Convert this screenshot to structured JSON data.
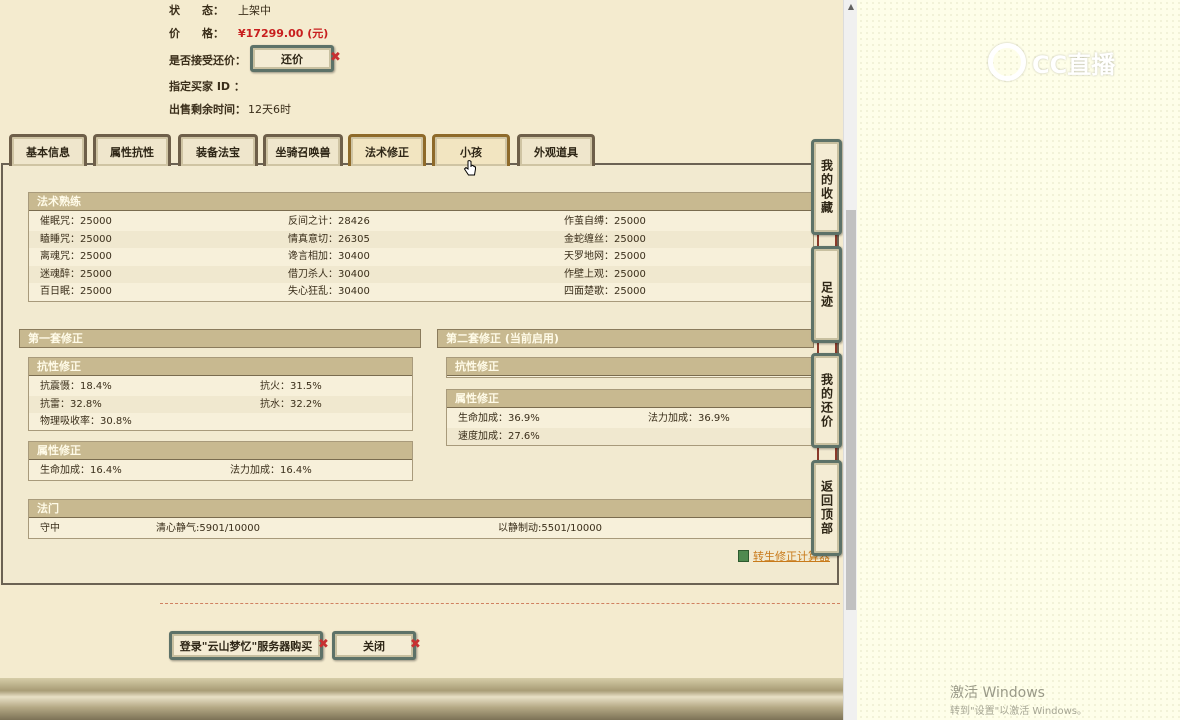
{
  "info": {
    "status_label": "状　　态：",
    "status_value": "上架中",
    "price_label": "价　　格：",
    "price_value": "¥17299.00 (元)",
    "counter_label": "是否接受还价：",
    "counter_button": "还价",
    "buyer_label": "指定买家 ID ：",
    "remaining_label": "出售剩余时间：",
    "remaining_value": "12天6时"
  },
  "tabs": [
    {
      "label": "基本信息"
    },
    {
      "label": "属性抗性"
    },
    {
      "label": "装备法宝"
    },
    {
      "label": "坐骑召唤兽"
    },
    {
      "label": "法术修正"
    },
    {
      "label": "小孩"
    },
    {
      "label": "外观道具"
    }
  ],
  "spell_mastery": {
    "title": "法术熟练",
    "rows": [
      [
        "催眠咒：25000",
        "反间之计：28426",
        "作茧自缚：25000"
      ],
      [
        "瞌睡咒：25000",
        "情真意切：26305",
        "金蛇缠丝：25000"
      ],
      [
        "离魂咒：25000",
        "谗言相加：30400",
        "天罗地网：25000"
      ],
      [
        "迷魂醉：25000",
        "借刀杀人：30400",
        "作壁上观：25000"
      ],
      [
        "百日眠：25000",
        "失心狂乱：30400",
        "四面楚歌：25000"
      ]
    ]
  },
  "set1": {
    "title": "第一套修正",
    "resist": {
      "title": "抗性修正",
      "rows": [
        [
          "抗震慑：18.4%",
          "抗火：31.5%"
        ],
        [
          "抗雷：32.8%",
          "抗水：32.2%"
        ],
        [
          "物理吸收率：30.8%",
          ""
        ]
      ]
    },
    "attr": {
      "title": "属性修正",
      "rows": [
        [
          "生命加成：16.4%",
          "法力加成：16.4%"
        ]
      ]
    }
  },
  "set2": {
    "title": "第二套修正 (当前启用)",
    "resist": {
      "title": "抗性修正"
    },
    "attr": {
      "title": "属性修正",
      "rows": [
        [
          "生命加成：36.9%",
          "法力加成：36.9%"
        ],
        [
          "速度加成：27.6%",
          ""
        ]
      ]
    }
  },
  "dharma": {
    "title": "法门",
    "row": [
      "守中",
      "清心静气:5901/10000",
      "以静制动:5501/10000"
    ]
  },
  "side_buttons": [
    {
      "label": "我的收藏"
    },
    {
      "label": "足迹"
    },
    {
      "label": "我的还价"
    },
    {
      "label": "返回顶部"
    }
  ],
  "calc_link": "转生修正计算器",
  "bottom": {
    "login_button": "登录\"云山梦忆\"服务器购买",
    "close_button": "关闭"
  },
  "desktop": {
    "logo_text": "CC直播",
    "windows_title": "激活 Windows",
    "windows_sub": "转到\"设置\"以激活 Windows。"
  }
}
